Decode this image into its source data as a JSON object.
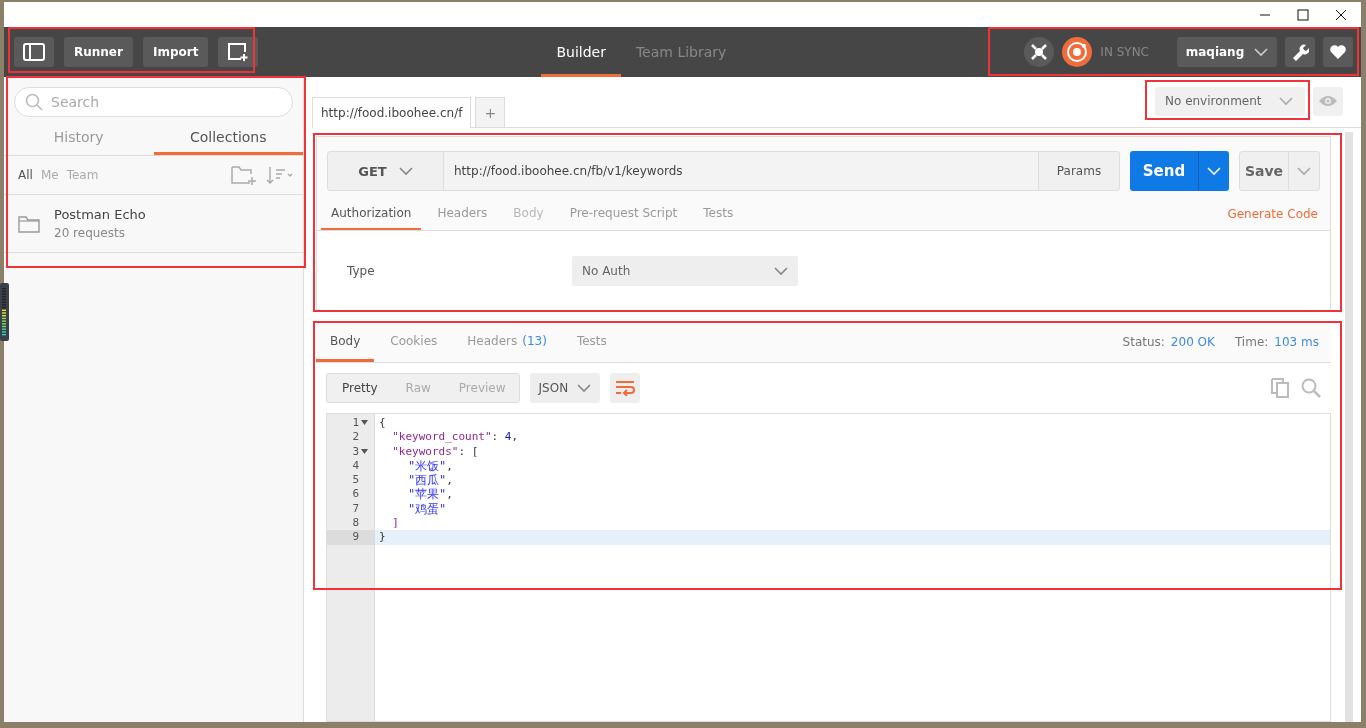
{
  "header": {
    "runner": "Runner",
    "import": "Import",
    "tabs": [
      {
        "label": "Builder",
        "selected": true
      },
      {
        "label": "Team Library",
        "selected": false
      }
    ],
    "sync": "IN SYNC",
    "user": "maqiang"
  },
  "sidebar": {
    "search": {
      "placeholder": "Search"
    },
    "tabs": [
      {
        "label": "History",
        "selected": false
      },
      {
        "label": "Collections",
        "selected": true
      }
    ],
    "filters": [
      {
        "label": "All",
        "selected": true
      },
      {
        "label": "Me",
        "selected": false
      },
      {
        "label": "Team",
        "selected": false
      }
    ],
    "collections": [
      {
        "name": "Postman Echo",
        "count": "20 requests"
      }
    ]
  },
  "request_tabs": [
    {
      "label": "http://food.iboohee.cn/f",
      "selected": true
    }
  ],
  "new_tab": "+",
  "environment": "No environment",
  "request": {
    "method": "GET",
    "url": "http://food.iboohee.cn/fb/v1/keywords",
    "params": "Params",
    "send": "Send",
    "save": "Save",
    "tabs": [
      {
        "label": "Authorization",
        "selected": true,
        "disabled": false
      },
      {
        "label": "Headers",
        "selected": false,
        "disabled": false
      },
      {
        "label": "Body",
        "selected": false,
        "disabled": true
      },
      {
        "label": "Pre-request Script",
        "selected": false,
        "disabled": false
      },
      {
        "label": "Tests",
        "selected": false,
        "disabled": false
      }
    ],
    "generate_code": "Generate Code",
    "auth_label": "Type",
    "auth_value": "No Auth"
  },
  "response": {
    "tabs": [
      {
        "label": "Body",
        "selected": true
      },
      {
        "label": "Cookies",
        "selected": false
      },
      {
        "label": "Headers",
        "count": "(13)",
        "selected": false
      },
      {
        "label": "Tests",
        "selected": false
      }
    ],
    "status_label": "Status:",
    "status": "200 OK",
    "time_label": "Time:",
    "time": "103 ms",
    "views": [
      {
        "label": "Pretty",
        "selected": true
      },
      {
        "label": "Raw",
        "selected": false
      },
      {
        "label": "Preview",
        "selected": false
      }
    ],
    "format": "JSON",
    "lines": [
      {
        "number": "1",
        "foldable": true,
        "active": false,
        "tokens": [
          {
            "kind": "punct",
            "text": "{"
          }
        ]
      },
      {
        "number": "2",
        "foldable": false,
        "active": false,
        "tokens": [
          {
            "kind": "key",
            "text": "  \"keyword_count\""
          },
          {
            "kind": "punct",
            "text": ": "
          },
          {
            "kind": "number",
            "text": "4"
          },
          {
            "kind": "punct",
            "text": ","
          }
        ]
      },
      {
        "number": "3",
        "foldable": true,
        "active": false,
        "tokens": [
          {
            "kind": "key",
            "text": "  \"keywords\""
          },
          {
            "kind": "punct",
            "text": ": ["
          }
        ]
      },
      {
        "number": "4",
        "foldable": false,
        "active": false,
        "tokens": [
          {
            "kind": "string",
            "text": "    \"米饭\""
          },
          {
            "kind": "punct",
            "text": ","
          }
        ]
      },
      {
        "number": "5",
        "foldable": false,
        "active": false,
        "tokens": [
          {
            "kind": "string",
            "text": "    \"西瓜\""
          },
          {
            "kind": "punct",
            "text": ","
          }
        ]
      },
      {
        "number": "6",
        "foldable": false,
        "active": false,
        "tokens": [
          {
            "kind": "string",
            "text": "    \"苹果\""
          },
          {
            "kind": "punct",
            "text": ","
          }
        ]
      },
      {
        "number": "7",
        "foldable": false,
        "active": false,
        "tokens": [
          {
            "kind": "string",
            "text": "    \"鸡蛋\""
          }
        ]
      },
      {
        "number": "8",
        "foldable": false,
        "active": false,
        "tokens": [
          {
            "kind": "bracket",
            "text": "  ]"
          }
        ]
      },
      {
        "number": "9",
        "foldable": false,
        "active": true,
        "tokens": [
          {
            "kind": "punct",
            "text": "}"
          }
        ]
      }
    ]
  }
}
